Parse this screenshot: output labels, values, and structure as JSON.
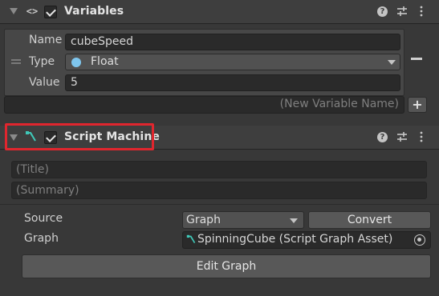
{
  "variables_component": {
    "title": "Variables",
    "enabled": true,
    "icon": "code-brackets-icon",
    "variable": {
      "name_label": "Name",
      "name_value": "cubeSpeed",
      "type_label": "Type",
      "type_value": "Float",
      "type_icon_color": "#7fc6ee",
      "value_label": "Value",
      "value_value": "5"
    },
    "new_variable_placeholder": "(New Variable Name)",
    "add_label": "+"
  },
  "script_machine_component": {
    "title": "Script Machine",
    "enabled": true,
    "icon": "script-graph-icon",
    "title_placeholder": "(Title)",
    "summary_placeholder": "(Summary)",
    "source_label": "Source",
    "source_value": "Graph",
    "convert_label": "Convert",
    "graph_label": "Graph",
    "graph_value": "SpinningCube (Script Graph Asset)",
    "edit_graph_label": "Edit Graph"
  },
  "colors": {
    "background": "#383838",
    "highlight": "#e0262e",
    "graph_icon": "#3fc8b8"
  }
}
